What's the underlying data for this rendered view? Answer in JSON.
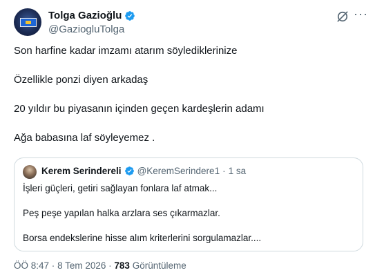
{
  "tweet": {
    "author": {
      "name": "Tolga Gazioğlu",
      "handle": "@GaziogluTolga",
      "verified": true
    },
    "lines": [
      "Son harfine kadar imzamı atarım söylediklerinize",
      "Özellikle ponzi diyen arkadaş",
      "20 yıldır bu piyasanın içinden geçen kardeşlerin adamı",
      "Ağa babasına laf söyleyemez ."
    ],
    "quote": {
      "name": "Kerem Serindereli",
      "handle": "@KeremSerindere1",
      "separator": "·",
      "time": "1 sa",
      "verified": true,
      "lines": [
        "İşleri güçleri, getiri sağlayan fonlara laf atmak...",
        "Peş peşe yapılan halka arzlara ses çıkarmazlar.",
        "Borsa endekslerine hisse alım kriterlerini sorgulamazlar...."
      ]
    },
    "meta": {
      "time": "ÖÖ 8:47",
      "separator": "·",
      "date": "8 Tem 2026",
      "views_count": "783",
      "views_label": "Görüntüleme"
    }
  },
  "colors": {
    "verified": "#1d9bf0",
    "secondary_text": "#536471",
    "primary_text": "#0f1419",
    "border": "#cfd9de"
  },
  "icons": {
    "grok": "grok-icon",
    "more": "more-options-icon",
    "verified": "verified-badge-icon"
  }
}
